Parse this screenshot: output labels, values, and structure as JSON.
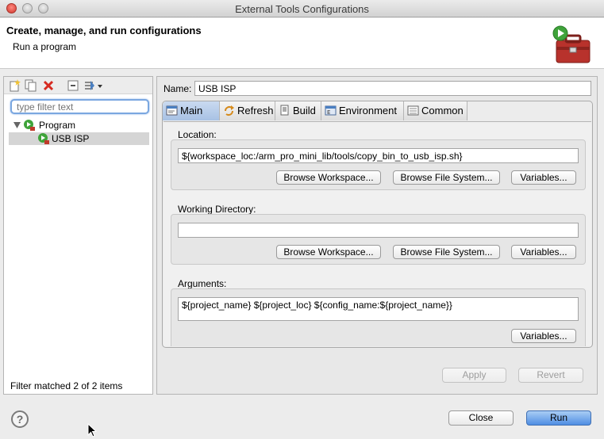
{
  "window": {
    "title": "External Tools Configurations"
  },
  "header": {
    "title": "Create, manage, and run configurations",
    "subtitle": "Run a program"
  },
  "filter": {
    "placeholder": "type filter text"
  },
  "tree": {
    "group_label": "Program",
    "item_label": "USB ISP"
  },
  "left_footer": {
    "text": "Filter matched 2 of 2 items"
  },
  "name": {
    "label": "Name:",
    "value": "USB ISP"
  },
  "tabs": [
    {
      "label": "Main"
    },
    {
      "label": "Refresh"
    },
    {
      "label": "Build"
    },
    {
      "label": "Environment"
    },
    {
      "label": "Common"
    }
  ],
  "location": {
    "label": "Location:",
    "value": "${workspace_loc:/arm_pro_mini_lib/tools/copy_bin_to_usb_isp.sh}",
    "browse_workspace": "Browse Workspace...",
    "browse_filesystem": "Browse File System...",
    "variables": "Variables..."
  },
  "working_dir": {
    "label": "Working Directory:",
    "value": "",
    "browse_workspace": "Browse Workspace...",
    "browse_filesystem": "Browse File System...",
    "variables": "Variables..."
  },
  "arguments": {
    "label": "Arguments:",
    "value": "${project_name} ${project_loc} ${config_name:${project_name}}",
    "variables": "Variables..."
  },
  "actions": {
    "apply": "Apply",
    "revert": "Revert",
    "close": "Close",
    "run": "Run"
  },
  "colors": {
    "accent": "#4f8ee3",
    "filter_focus": "#7aa7e0"
  }
}
